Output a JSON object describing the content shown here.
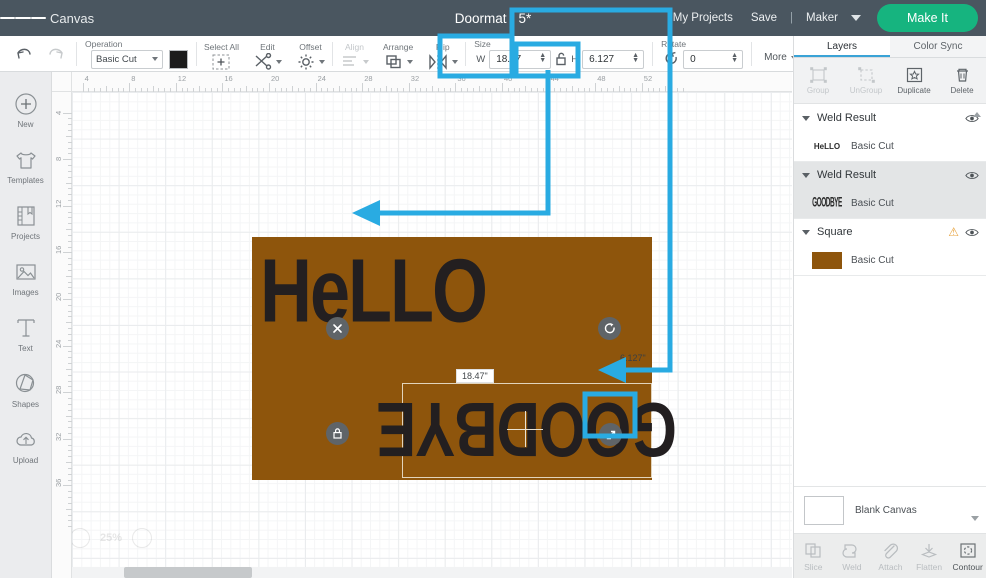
{
  "topbar": {
    "menu_icon": "hamburger-icon",
    "canvas_label": "Canvas",
    "project_title": "Doormat - 5*",
    "my_projects": "My Projects",
    "save": "Save",
    "separator": "|",
    "machine": "Maker",
    "make_it": "Make It",
    "bg_color": "#4a5660",
    "accent_color": "#16b47f"
  },
  "toolbar": {
    "undo_icon": "undo-icon",
    "redo_icon": "redo-icon",
    "operation_label": "Operation",
    "operation_value": "Basic Cut",
    "color_swatch": "#1c1c1c",
    "select_all_label": "Select All",
    "edit_label": "Edit",
    "offset_label": "Offset",
    "align_label": "Align",
    "arrange_label": "Arrange",
    "flip_label": "Flip",
    "size_label": "Size",
    "width_prefix": "W",
    "width_value": "18.47",
    "height_prefix": "H",
    "height_value": "6.127",
    "lock_icon": "lock-open-icon",
    "rotate_label": "Rotate",
    "rotate_value": "0",
    "more_label": "More"
  },
  "rail": {
    "items": [
      {
        "label": "New",
        "icon": "plus-circle-icon"
      },
      {
        "label": "Templates",
        "icon": "tshirt-icon"
      },
      {
        "label": "Projects",
        "icon": "book-icon"
      },
      {
        "label": "Images",
        "icon": "picture-icon"
      },
      {
        "label": "Text",
        "icon": "text-t-icon"
      },
      {
        "label": "Shapes",
        "icon": "shapes-icon"
      },
      {
        "label": "Upload",
        "icon": "upload-cloud-icon"
      }
    ]
  },
  "canvas": {
    "ruler_h": [
      "4",
      "8",
      "12",
      "16",
      "20",
      "24",
      "28",
      "32",
      "36",
      "40",
      "44",
      "48",
      "52"
    ],
    "ruler_v": [
      "4",
      "8",
      "12",
      "16",
      "20",
      "24",
      "28",
      "32",
      "36"
    ],
    "mat_color": "#8e550c",
    "hello_text": "HeLLO",
    "goodbye_text": "GOODBYE",
    "width_badge": "18.47\"",
    "height_badge": "6.127\"",
    "delete_handle": "delete-handle",
    "rotate_handle": "rotate-handle",
    "lock_handle": "lock-handle",
    "resize_handle": "resize-handle",
    "zoom_level": "25%",
    "zoom_out_icon": "zoom-out-icon",
    "zoom_in_icon": "zoom-in-icon"
  },
  "right_panel": {
    "tab_layers": "Layers",
    "tab_color_sync": "Color Sync",
    "actions": [
      {
        "label": "Group",
        "icon": "group-icon",
        "enabled": false
      },
      {
        "label": "UnGroup",
        "icon": "ungroup-icon",
        "enabled": false
      },
      {
        "label": "Duplicate",
        "icon": "duplicate-icon",
        "enabled": true
      },
      {
        "label": "Delete",
        "icon": "trash-icon",
        "enabled": true
      }
    ],
    "layers": [
      {
        "name": "Weld Result",
        "thumb_text": "HeLLO",
        "cut": "Basic Cut",
        "selected": false,
        "warning": false
      },
      {
        "name": "Weld Result",
        "thumb_text": "GOODBYE",
        "cut": "Basic Cut",
        "selected": true,
        "warning": false
      },
      {
        "name": "Square",
        "thumb_text": "",
        "cut": "Basic Cut",
        "selected": false,
        "warning": true
      }
    ],
    "blank_canvas_label": "Blank Canvas",
    "tools": [
      {
        "label": "Slice",
        "icon": "slice-icon",
        "enabled": false
      },
      {
        "label": "Weld",
        "icon": "weld-icon",
        "enabled": false
      },
      {
        "label": "Attach",
        "icon": "paperclip-icon",
        "enabled": false
      },
      {
        "label": "Flatten",
        "icon": "flatten-icon",
        "enabled": false
      },
      {
        "label": "Contour",
        "icon": "contour-icon",
        "enabled": true
      }
    ]
  },
  "annotations": {
    "color": "#29ABE2",
    "highlight_width_field": "width-field-highlight",
    "highlight_height_field": "height-field-highlight",
    "highlight_resize_handle": "resize-handle-highlight",
    "arrow_to_hello": "arrow-pointing-to-hello-object",
    "arrow_to_goodbye": "arrow-pointing-to-goodbye-object"
  }
}
